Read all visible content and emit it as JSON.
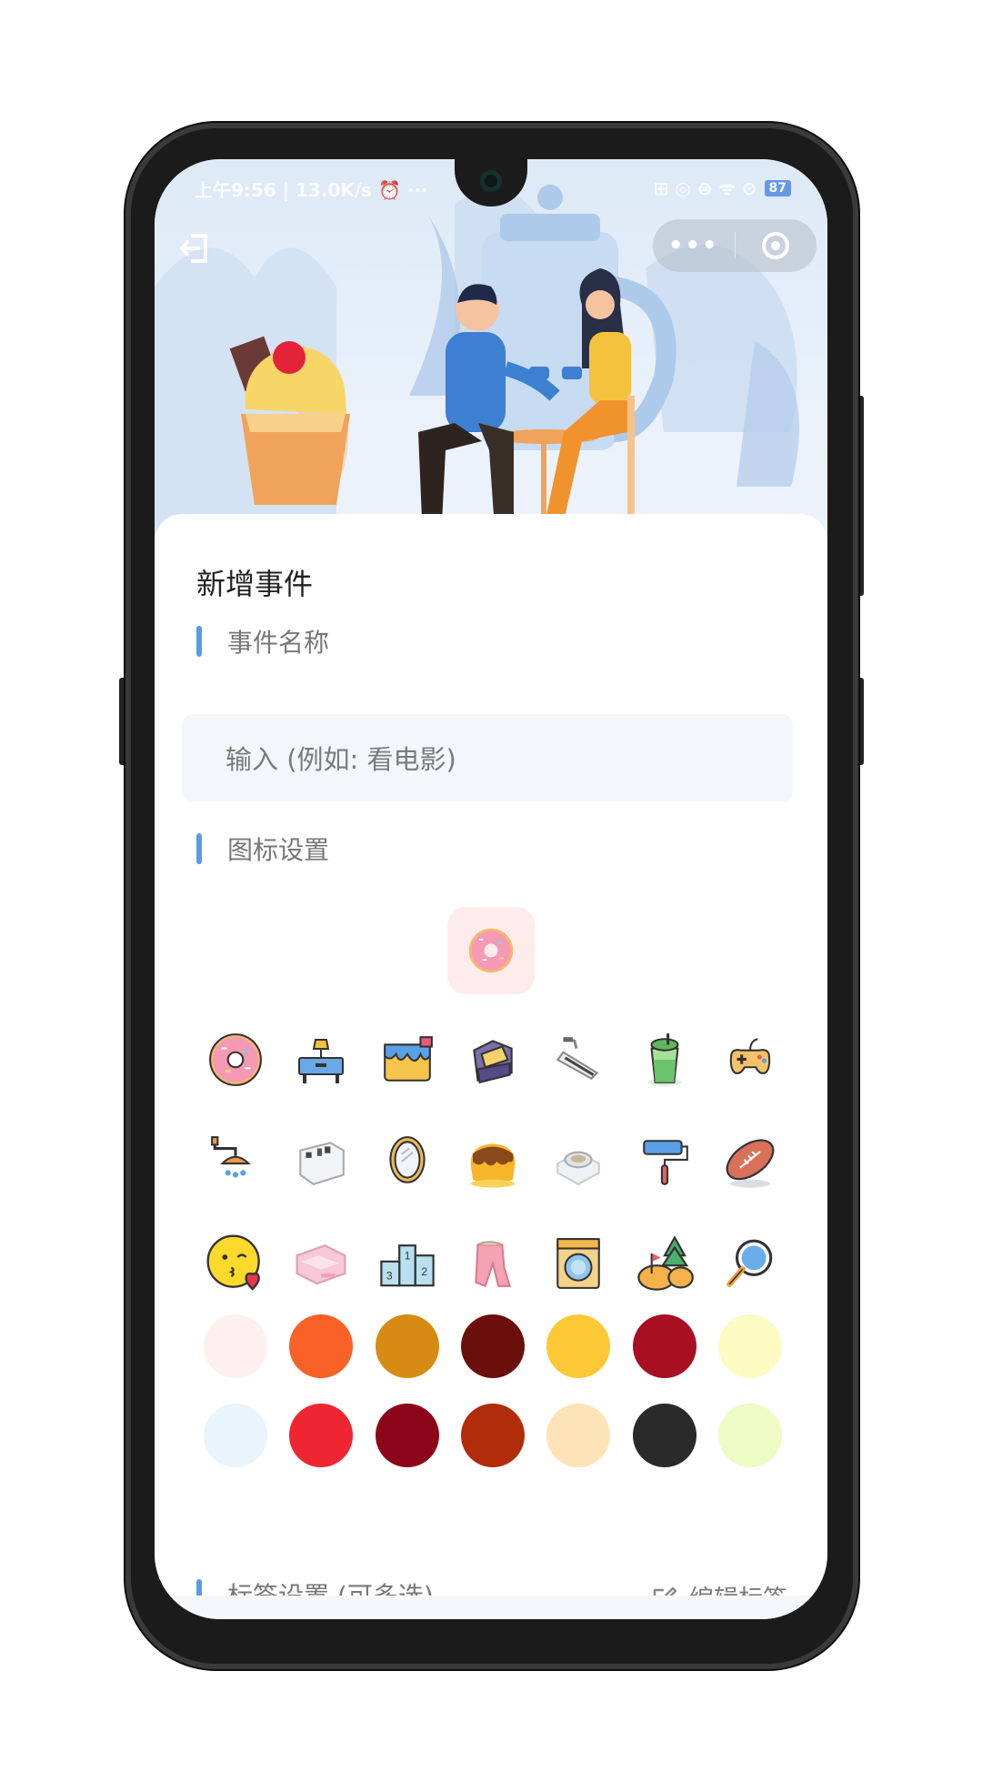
{
  "status_bar": {
    "left": "上午9:56 | 13.0K/s ⏰ ···",
    "right": "⊞ ◎ ⊜ ᯤ ⊙",
    "battery": "87"
  },
  "capsule": {
    "more_label": "•••"
  },
  "form": {
    "title": "新增事件",
    "name_section": "事件名称",
    "name_placeholder": "输入 (例如: 看电影)",
    "icon_section": "图标设置",
    "tag_section": "标签设置 (可多选)",
    "edit_tag_label": "编辑标签"
  },
  "selected_icon": "donut-icon",
  "icons": [
    "donut-icon",
    "desk-lamp-icon",
    "paint-bucket-icon",
    "armchair-icon",
    "treadmill-icon",
    "drink-cup-icon",
    "gamepad-icon",
    "shower-icon",
    "dresser-icon",
    "mirror-icon",
    "pudding-icon",
    "cooker-icon",
    "paint-roller-icon",
    "football-icon",
    "kiss-emoji-icon",
    "shelf-icon",
    "podium-icon",
    "scarf-icon",
    "washing-machine-icon",
    "golf-icon",
    "magnifier-icon"
  ],
  "colors": [
    "#fdf0ef",
    "#f96126",
    "#d68b12",
    "#6b0f0a",
    "#fdc835",
    "#a80f22",
    "#fcfbc2",
    "#e9f4fc",
    "#ef2532",
    "#8d0519",
    "#b12c0a",
    "#fde3b8",
    "#2a2a2a",
    "#eefbc4"
  ],
  "accent_color": "#5b9ae6"
}
